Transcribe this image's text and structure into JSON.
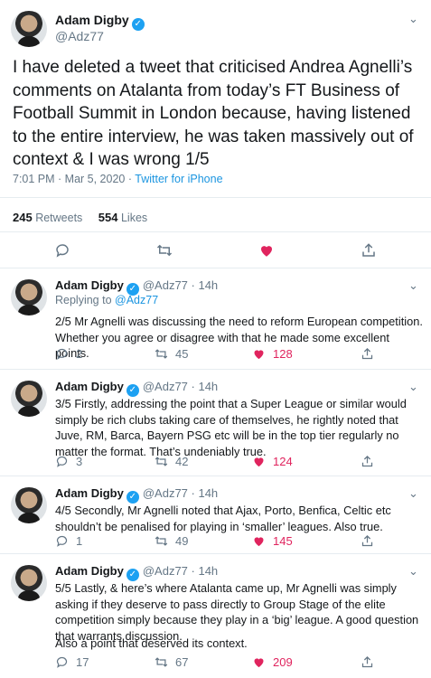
{
  "main": {
    "name": "Adam Digby",
    "handle": "@Adz77",
    "text": "I have deleted a tweet that criticised Andrea Agnelli’s comments on Atalanta from today’s FT Business of Football Summit in London because, having listened to the entire interview, he was taken massively out of context & I was wrong 1/5",
    "time": "7:01 PM · Mar 5, 2020 · ",
    "source": "Twitter for iPhone",
    "retweets_count": "245",
    "retweets_label": "Retweets",
    "likes_count": "554",
    "likes_label": "Likes"
  },
  "replies": [
    {
      "name": "Adam Digby",
      "handle": "@Adz77",
      "age": "· 14h",
      "replying_prefix": "Replying to ",
      "replying_to": "@Adz77",
      "text": "2/5 Mr Agnelli was discussing the need to reform European competition. Whether you agree or disagree with that he made some excellent points.",
      "replies": "2",
      "retweets": "45",
      "likes": "128"
    },
    {
      "name": "Adam Digby",
      "handle": "@Adz77",
      "age": "· 14h",
      "text": "3/5 Firstly, addressing the point that a Super League or similar would simply be rich clubs taking care of themselves, he rightly noted that Juve, RM, Barca, Bayern PSG etc will be in the top tier regularly no matter the format. That’s undeniably true.",
      "replies": "3",
      "retweets": "42",
      "likes": "124"
    },
    {
      "name": "Adam Digby",
      "handle": "@Adz77",
      "age": "· 14h",
      "text": "4/5 Secondly, Mr Agnelli noted that Ajax, Porto, Benfica, Celtic etc shouldn’t be penalised for playing in ‘smaller’ leagues. Also true.",
      "replies": "1",
      "retweets": "49",
      "likes": "145"
    },
    {
      "name": "Adam Digby",
      "handle": "@Adz77",
      "age": "· 14h",
      "text": "5/5 Lastly, & here’s where Atalanta came up, Mr Agnelli was simply asking if they deserve to pass directly to Group Stage of the elite competition simply because they play in a ‘big’ league. A good question that warrants discussion.",
      "text2": "Also a point that deserved its context.",
      "replies": "17",
      "retweets": "67",
      "likes": "209"
    }
  ],
  "colors": {
    "accent": "#1da1f2",
    "link": "#1b95e0",
    "like": "#e0245e",
    "muted": "#657786"
  },
  "icons": [
    "verified-badge-icon",
    "chevron-down-icon",
    "reply-icon",
    "retweet-icon",
    "heart-icon",
    "share-icon"
  ]
}
